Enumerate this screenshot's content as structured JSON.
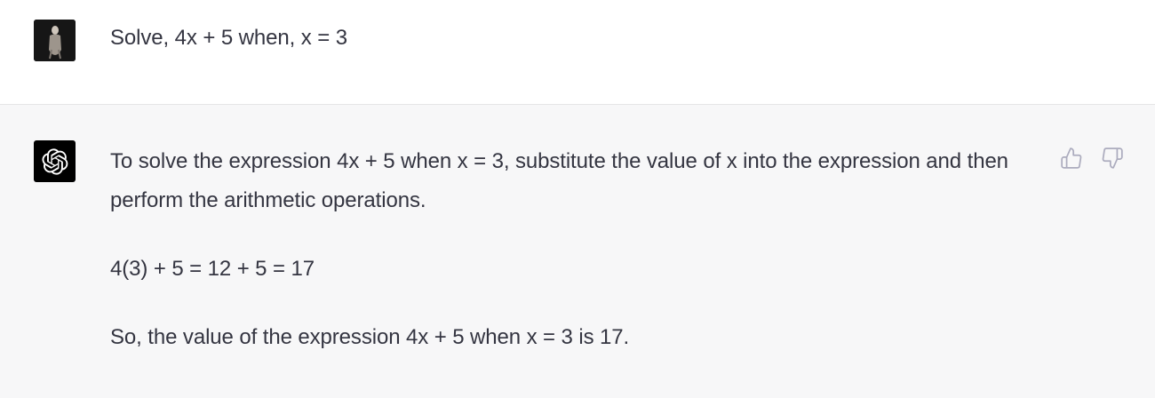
{
  "conversation": {
    "user_message": {
      "avatar_icon": "user-avatar",
      "text": "Solve, 4x + 5 when, x = 3"
    },
    "assistant_message": {
      "avatar_icon": "openai-logo-icon",
      "paragraphs": [
        "To solve the expression 4x + 5 when x = 3, substitute the value of x into the expression and then perform the arithmetic operations.",
        "4(3) + 5 = 12 + 5 = 17",
        "So, the value of the expression 4x + 5 when x = 3 is 17."
      ],
      "feedback": {
        "thumbs_up_icon": "thumbs-up-icon",
        "thumbs_down_icon": "thumbs-down-icon"
      }
    }
  },
  "colors": {
    "text": "#343541",
    "assistant_bg": "#f7f7f8",
    "user_bg": "#ffffff",
    "icon_gray": "#acacbe"
  }
}
